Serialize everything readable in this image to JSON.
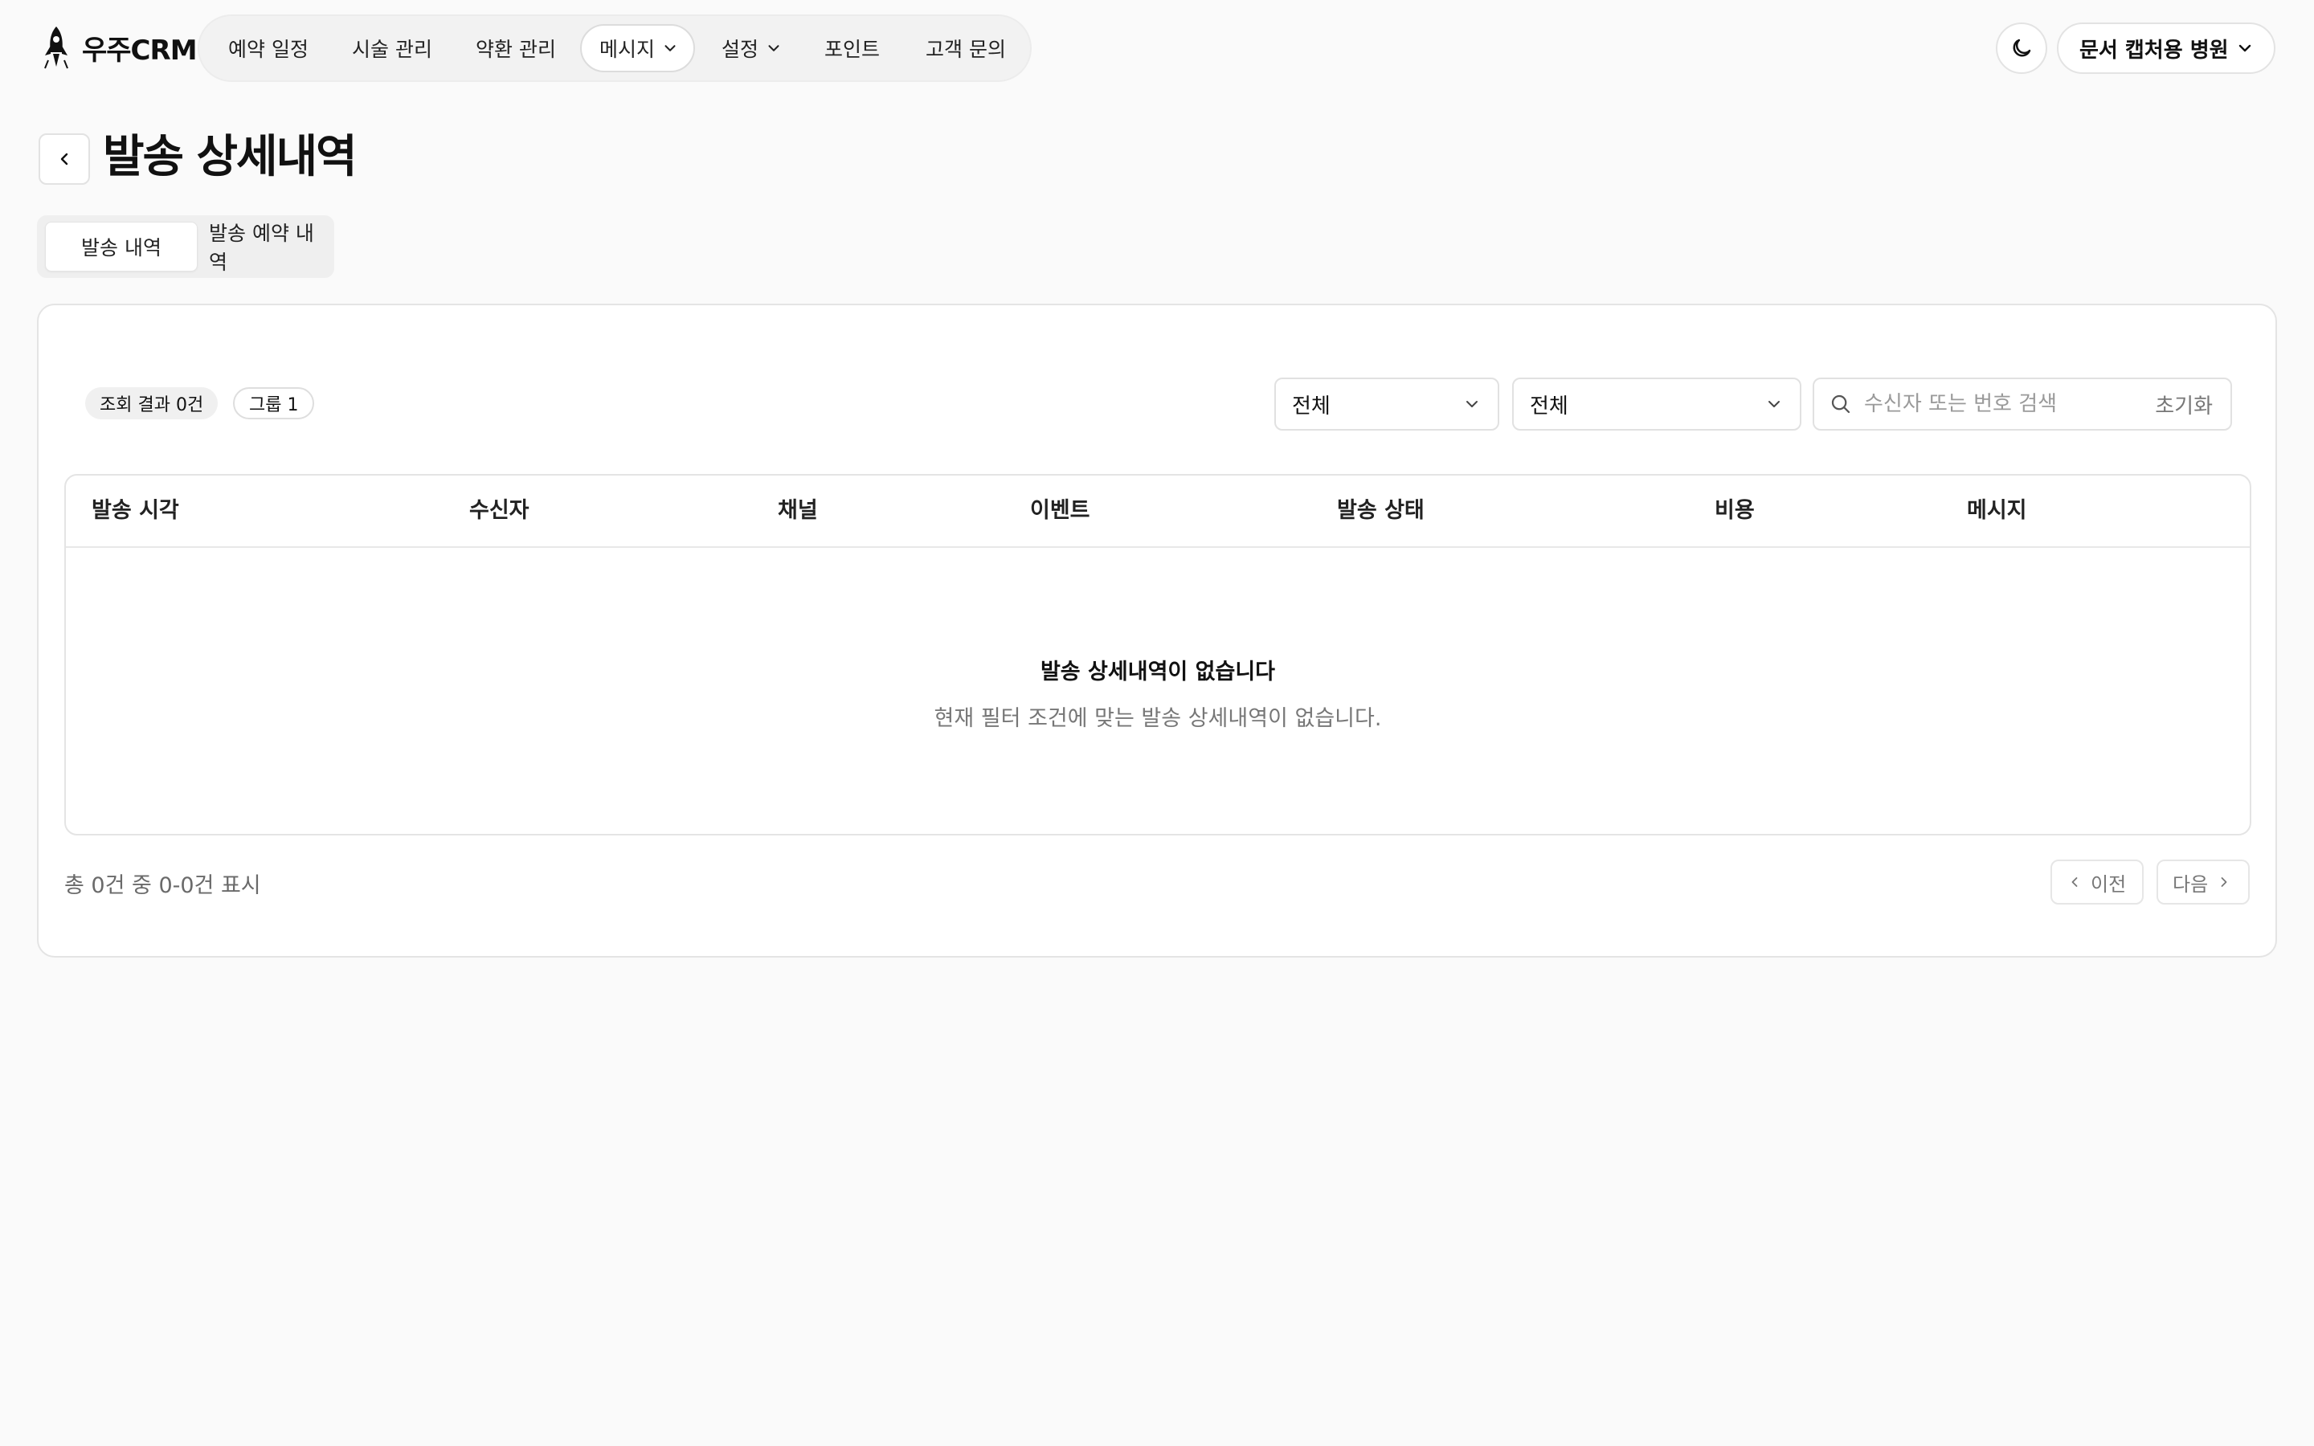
{
  "app": {
    "logo_text": "우주CRM",
    "nav": [
      {
        "label": "예약 일정"
      },
      {
        "label": "시술 관리"
      },
      {
        "label": "약환 관리"
      },
      {
        "label": "메시지"
      },
      {
        "label": "설정"
      },
      {
        "label": "포인트"
      },
      {
        "label": "고객 문의"
      }
    ],
    "clinic_name": "문서 캡처용 병원"
  },
  "page": {
    "title": "발송 상세내역",
    "tabs": [
      {
        "label": "발송 내역",
        "active": true
      },
      {
        "label": "발송 예약 내역",
        "active": false
      }
    ]
  },
  "filters": {
    "result_badge": "조회 결과 0건",
    "group_badge": "그룹 1",
    "select_1": "전체",
    "select_2": "전체",
    "search_placeholder": "수신자 또는 번호 검색",
    "search_value": "",
    "reset_label": "초기화"
  },
  "table": {
    "columns": [
      "발송 시각",
      "수신자",
      "채널",
      "이벤트",
      "발송 상태",
      "비용",
      "메시지"
    ],
    "rows": [],
    "empty_title": "발송 상세내역이 없습니다",
    "empty_desc": "현재 필터 조건에 맞는 발송 상세내역이 없습니다."
  },
  "pagination": {
    "summary": "총 0건 중 0-0건 표시",
    "prev_label": "이전",
    "next_label": "다음"
  }
}
